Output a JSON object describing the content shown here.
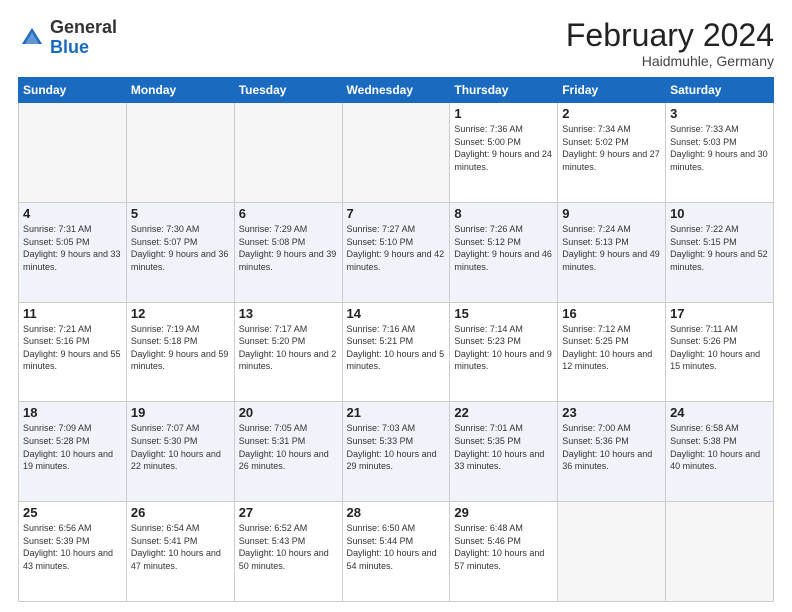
{
  "header": {
    "logo_general": "General",
    "logo_blue": "Blue",
    "month_title": "February 2024",
    "location": "Haidmuhle, Germany"
  },
  "days_of_week": [
    "Sunday",
    "Monday",
    "Tuesday",
    "Wednesday",
    "Thursday",
    "Friday",
    "Saturday"
  ],
  "weeks": [
    [
      {
        "day": "",
        "sunrise": "",
        "sunset": "",
        "daylight": "",
        "empty": true
      },
      {
        "day": "",
        "sunrise": "",
        "sunset": "",
        "daylight": "",
        "empty": true
      },
      {
        "day": "",
        "sunrise": "",
        "sunset": "",
        "daylight": "",
        "empty": true
      },
      {
        "day": "",
        "sunrise": "",
        "sunset": "",
        "daylight": "",
        "empty": true
      },
      {
        "day": "1",
        "sunrise": "Sunrise: 7:36 AM",
        "sunset": "Sunset: 5:00 PM",
        "daylight": "Daylight: 9 hours and 24 minutes.",
        "empty": false
      },
      {
        "day": "2",
        "sunrise": "Sunrise: 7:34 AM",
        "sunset": "Sunset: 5:02 PM",
        "daylight": "Daylight: 9 hours and 27 minutes.",
        "empty": false
      },
      {
        "day": "3",
        "sunrise": "Sunrise: 7:33 AM",
        "sunset": "Sunset: 5:03 PM",
        "daylight": "Daylight: 9 hours and 30 minutes.",
        "empty": false
      }
    ],
    [
      {
        "day": "4",
        "sunrise": "Sunrise: 7:31 AM",
        "sunset": "Sunset: 5:05 PM",
        "daylight": "Daylight: 9 hours and 33 minutes.",
        "empty": false
      },
      {
        "day": "5",
        "sunrise": "Sunrise: 7:30 AM",
        "sunset": "Sunset: 5:07 PM",
        "daylight": "Daylight: 9 hours and 36 minutes.",
        "empty": false
      },
      {
        "day": "6",
        "sunrise": "Sunrise: 7:29 AM",
        "sunset": "Sunset: 5:08 PM",
        "daylight": "Daylight: 9 hours and 39 minutes.",
        "empty": false
      },
      {
        "day": "7",
        "sunrise": "Sunrise: 7:27 AM",
        "sunset": "Sunset: 5:10 PM",
        "daylight": "Daylight: 9 hours and 42 minutes.",
        "empty": false
      },
      {
        "day": "8",
        "sunrise": "Sunrise: 7:26 AM",
        "sunset": "Sunset: 5:12 PM",
        "daylight": "Daylight: 9 hours and 46 minutes.",
        "empty": false
      },
      {
        "day": "9",
        "sunrise": "Sunrise: 7:24 AM",
        "sunset": "Sunset: 5:13 PM",
        "daylight": "Daylight: 9 hours and 49 minutes.",
        "empty": false
      },
      {
        "day": "10",
        "sunrise": "Sunrise: 7:22 AM",
        "sunset": "Sunset: 5:15 PM",
        "daylight": "Daylight: 9 hours and 52 minutes.",
        "empty": false
      }
    ],
    [
      {
        "day": "11",
        "sunrise": "Sunrise: 7:21 AM",
        "sunset": "Sunset: 5:16 PM",
        "daylight": "Daylight: 9 hours and 55 minutes.",
        "empty": false
      },
      {
        "day": "12",
        "sunrise": "Sunrise: 7:19 AM",
        "sunset": "Sunset: 5:18 PM",
        "daylight": "Daylight: 9 hours and 59 minutes.",
        "empty": false
      },
      {
        "day": "13",
        "sunrise": "Sunrise: 7:17 AM",
        "sunset": "Sunset: 5:20 PM",
        "daylight": "Daylight: 10 hours and 2 minutes.",
        "empty": false
      },
      {
        "day": "14",
        "sunrise": "Sunrise: 7:16 AM",
        "sunset": "Sunset: 5:21 PM",
        "daylight": "Daylight: 10 hours and 5 minutes.",
        "empty": false
      },
      {
        "day": "15",
        "sunrise": "Sunrise: 7:14 AM",
        "sunset": "Sunset: 5:23 PM",
        "daylight": "Daylight: 10 hours and 9 minutes.",
        "empty": false
      },
      {
        "day": "16",
        "sunrise": "Sunrise: 7:12 AM",
        "sunset": "Sunset: 5:25 PM",
        "daylight": "Daylight: 10 hours and 12 minutes.",
        "empty": false
      },
      {
        "day": "17",
        "sunrise": "Sunrise: 7:11 AM",
        "sunset": "Sunset: 5:26 PM",
        "daylight": "Daylight: 10 hours and 15 minutes.",
        "empty": false
      }
    ],
    [
      {
        "day": "18",
        "sunrise": "Sunrise: 7:09 AM",
        "sunset": "Sunset: 5:28 PM",
        "daylight": "Daylight: 10 hours and 19 minutes.",
        "empty": false
      },
      {
        "day": "19",
        "sunrise": "Sunrise: 7:07 AM",
        "sunset": "Sunset: 5:30 PM",
        "daylight": "Daylight: 10 hours and 22 minutes.",
        "empty": false
      },
      {
        "day": "20",
        "sunrise": "Sunrise: 7:05 AM",
        "sunset": "Sunset: 5:31 PM",
        "daylight": "Daylight: 10 hours and 26 minutes.",
        "empty": false
      },
      {
        "day": "21",
        "sunrise": "Sunrise: 7:03 AM",
        "sunset": "Sunset: 5:33 PM",
        "daylight": "Daylight: 10 hours and 29 minutes.",
        "empty": false
      },
      {
        "day": "22",
        "sunrise": "Sunrise: 7:01 AM",
        "sunset": "Sunset: 5:35 PM",
        "daylight": "Daylight: 10 hours and 33 minutes.",
        "empty": false
      },
      {
        "day": "23",
        "sunrise": "Sunrise: 7:00 AM",
        "sunset": "Sunset: 5:36 PM",
        "daylight": "Daylight: 10 hours and 36 minutes.",
        "empty": false
      },
      {
        "day": "24",
        "sunrise": "Sunrise: 6:58 AM",
        "sunset": "Sunset: 5:38 PM",
        "daylight": "Daylight: 10 hours and 40 minutes.",
        "empty": false
      }
    ],
    [
      {
        "day": "25",
        "sunrise": "Sunrise: 6:56 AM",
        "sunset": "Sunset: 5:39 PM",
        "daylight": "Daylight: 10 hours and 43 minutes.",
        "empty": false
      },
      {
        "day": "26",
        "sunrise": "Sunrise: 6:54 AM",
        "sunset": "Sunset: 5:41 PM",
        "daylight": "Daylight: 10 hours and 47 minutes.",
        "empty": false
      },
      {
        "day": "27",
        "sunrise": "Sunrise: 6:52 AM",
        "sunset": "Sunset: 5:43 PM",
        "daylight": "Daylight: 10 hours and 50 minutes.",
        "empty": false
      },
      {
        "day": "28",
        "sunrise": "Sunrise: 6:50 AM",
        "sunset": "Sunset: 5:44 PM",
        "daylight": "Daylight: 10 hours and 54 minutes.",
        "empty": false
      },
      {
        "day": "29",
        "sunrise": "Sunrise: 6:48 AM",
        "sunset": "Sunset: 5:46 PM",
        "daylight": "Daylight: 10 hours and 57 minutes.",
        "empty": false
      },
      {
        "day": "",
        "sunrise": "",
        "sunset": "",
        "daylight": "",
        "empty": true
      },
      {
        "day": "",
        "sunrise": "",
        "sunset": "",
        "daylight": "",
        "empty": true
      }
    ]
  ]
}
